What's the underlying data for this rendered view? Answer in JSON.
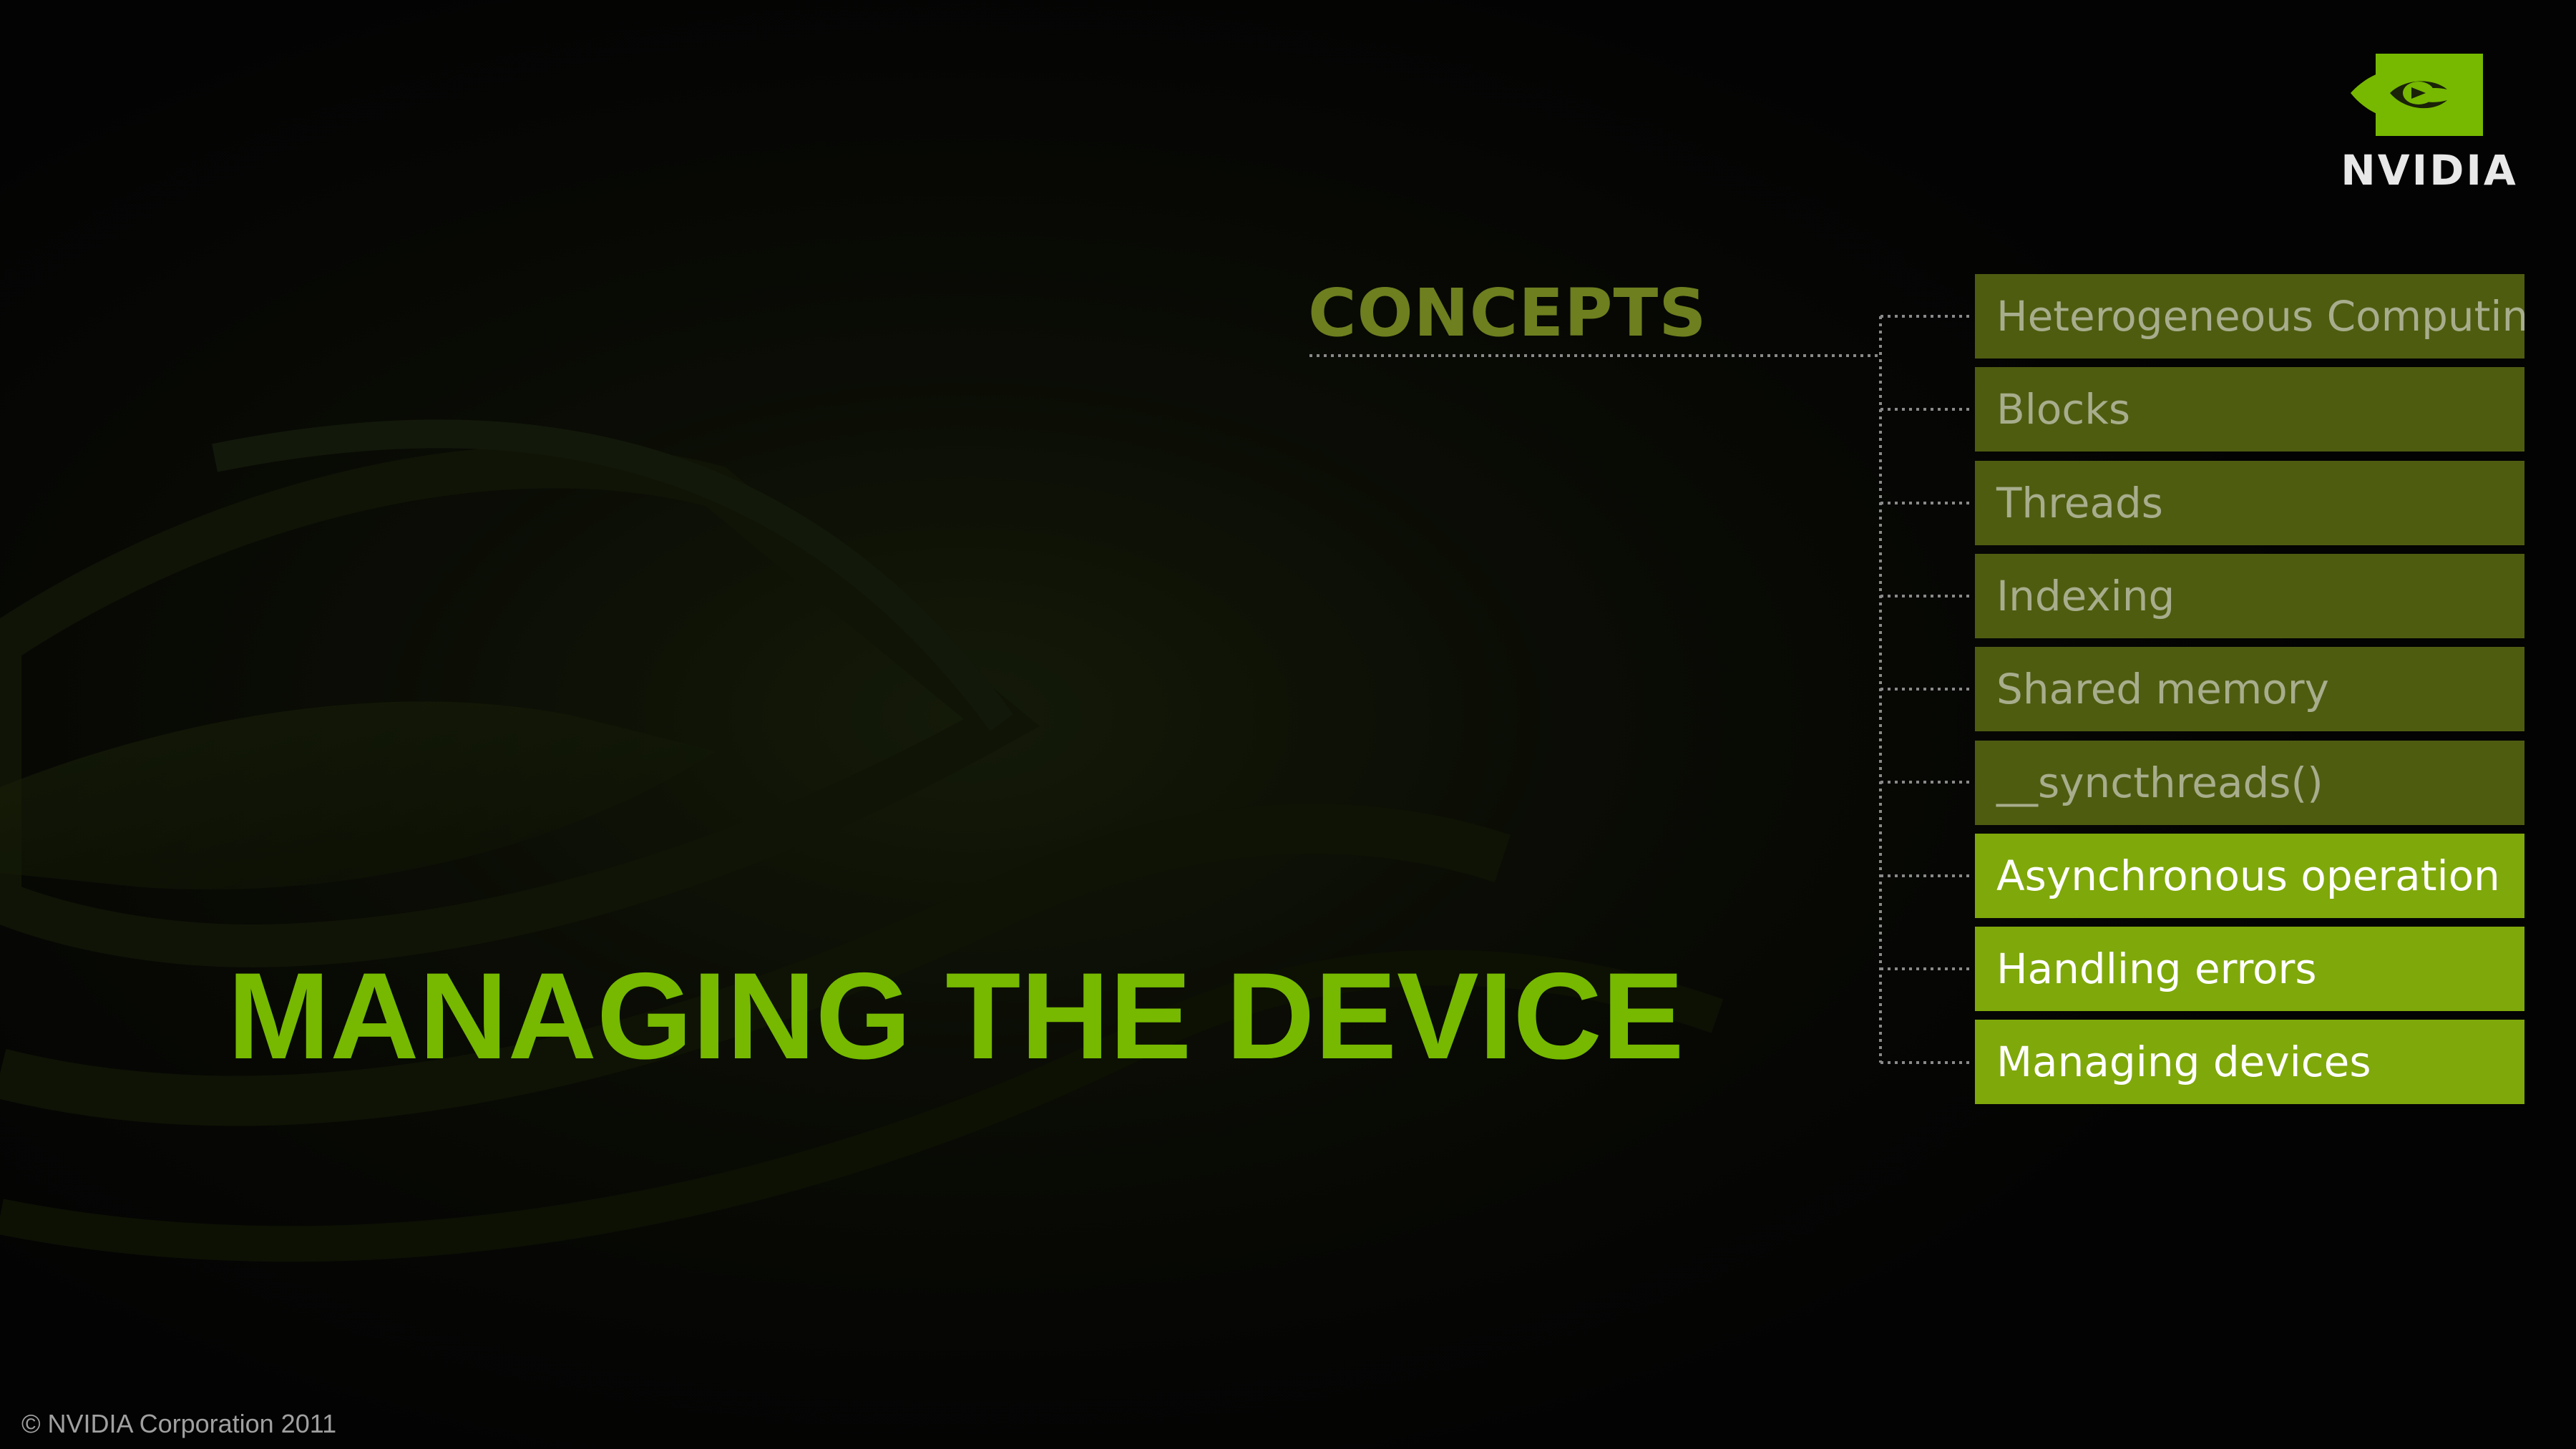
{
  "brand": {
    "logo_text": "NVIDIA",
    "accent_color": "#76b900",
    "dim_item_color": "#4e5c10",
    "bright_item_color": "#7fa80a"
  },
  "section": {
    "title": "CONCEPTS"
  },
  "concepts": [
    {
      "label": "Heterogeneous Computing",
      "state": "dim"
    },
    {
      "label": "Blocks",
      "state": "dim"
    },
    {
      "label": "Threads",
      "state": "dim"
    },
    {
      "label": "Indexing",
      "state": "dim"
    },
    {
      "label": "Shared memory",
      "state": "dim"
    },
    {
      "label": "__syncthreads()",
      "state": "dim"
    },
    {
      "label": "Asynchronous operation",
      "state": "bright"
    },
    {
      "label": "Handling errors",
      "state": "bright"
    },
    {
      "label": "Managing devices",
      "state": "bright"
    }
  ],
  "slide": {
    "title": "MANAGING THE DEVICE",
    "copyright": "© NVIDIA Corporation 2011"
  }
}
